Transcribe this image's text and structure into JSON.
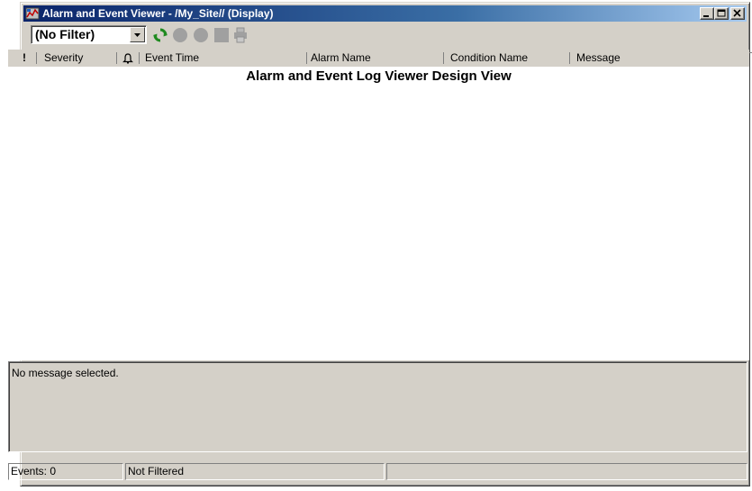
{
  "window": {
    "title": "Alarm and Event Viewer - /My_Site// (Display)"
  },
  "toolbar": {
    "filter": {
      "selected": "(No Filter)"
    }
  },
  "grid": {
    "columns": {
      "ack": "!",
      "severity": "Severity",
      "bell": "bell-icon",
      "event_time": "Event Time",
      "alarm_name": "Alarm Name",
      "condition_name": "Condition Name",
      "message": "Message"
    },
    "design_title": "Alarm and Event Log Viewer Design View"
  },
  "details": {
    "text": "No message selected."
  },
  "status": {
    "events": "Events: 0",
    "filter_state": "Not Filtered",
    "extra": ""
  },
  "colors": {
    "titlebar_start": "#0a246a",
    "titlebar_end": "#a6caf0",
    "face": "#d4d0c8",
    "refresh_green": "#1f8a1f",
    "disabled_gray": "#a0a0a0"
  }
}
